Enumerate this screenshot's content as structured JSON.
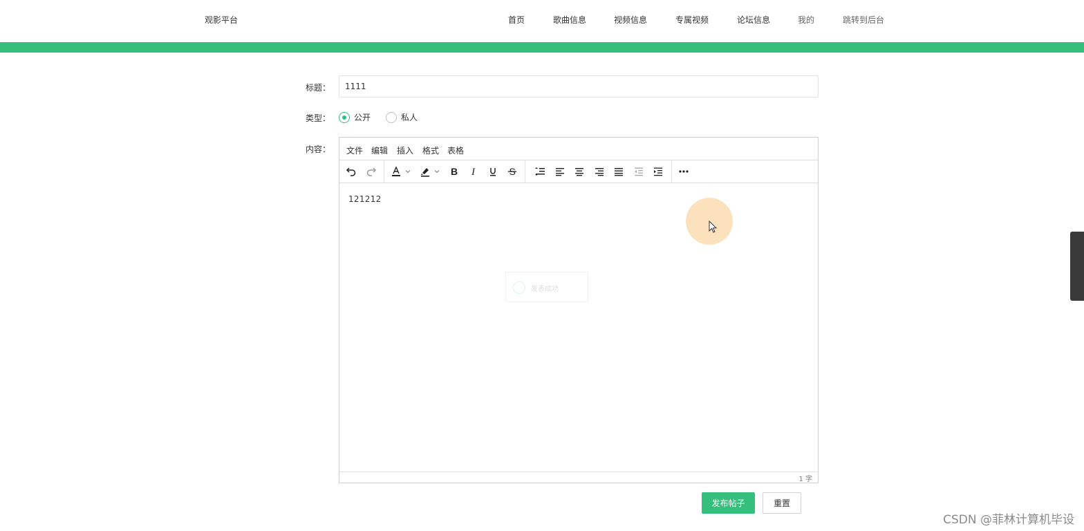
{
  "header": {
    "brand": "观影平台",
    "nav": [
      {
        "label": "首页"
      },
      {
        "label": "歌曲信息"
      },
      {
        "label": "视频信息"
      },
      {
        "label": "专属视频"
      },
      {
        "label": "论坛信息"
      },
      {
        "label": "我的"
      },
      {
        "label": "跳转到后台"
      }
    ],
    "accent_color": "#34c07c"
  },
  "form": {
    "title_label": "标题：",
    "title_value": "1111",
    "type_label": "类型：",
    "type_options": [
      {
        "label": "公开",
        "checked": true
      },
      {
        "label": "私人",
        "checked": false
      }
    ],
    "content_label": "内容："
  },
  "editor": {
    "menus": [
      "文件",
      "编辑",
      "插入",
      "格式",
      "表格"
    ],
    "toolbar_icons": [
      "undo-icon",
      "redo-icon",
      "text-color-icon",
      "highlight-color-icon",
      "bold-icon",
      "italic-icon",
      "underline-icon",
      "strikethrough-icon",
      "line-height-icon",
      "align-left-icon",
      "align-center-icon",
      "align-right-icon",
      "align-justify-icon",
      "outdent-icon",
      "indent-icon",
      "more-icon"
    ],
    "content": "121212",
    "word_count": "1 字"
  },
  "toast": {
    "text": "发表成功"
  },
  "actions": {
    "submit_label": "发布帖子",
    "reset_label": "重置"
  },
  "watermark": "CSDN @菲林计算机毕设"
}
